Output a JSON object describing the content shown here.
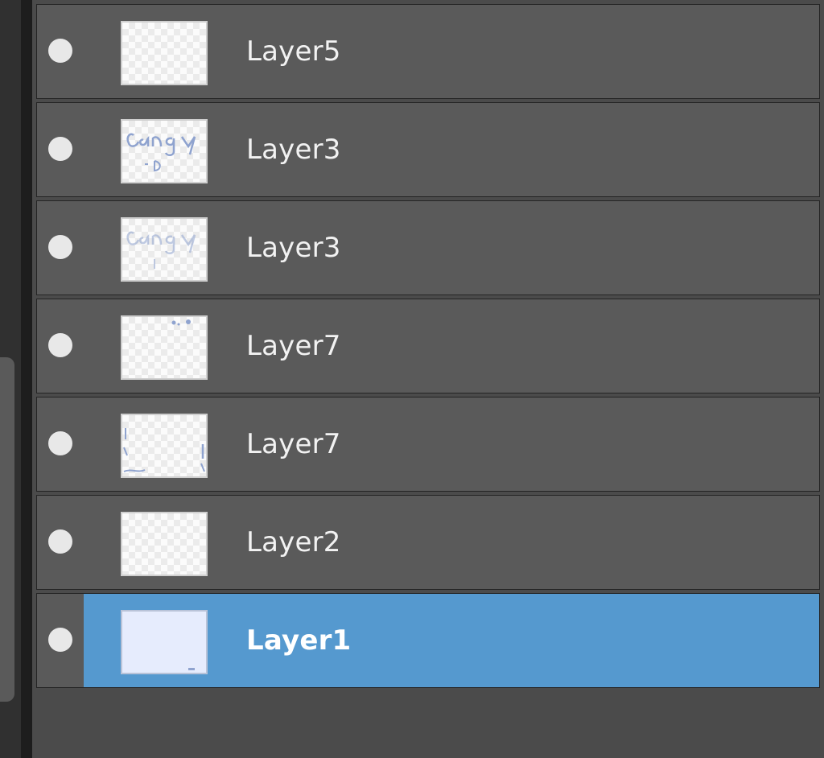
{
  "layers_panel": {
    "layers": [
      {
        "name": "Layer5",
        "thumbnail": "empty",
        "selected": false
      },
      {
        "name": "Layer3",
        "thumbnail": "text-sketch",
        "selected": false
      },
      {
        "name": "Layer3",
        "thumbnail": "text-sketch-faint",
        "selected": false
      },
      {
        "name": "Layer7",
        "thumbnail": "dots",
        "selected": false
      },
      {
        "name": "Layer7",
        "thumbnail": "edge-marks",
        "selected": false
      },
      {
        "name": "Layer2",
        "thumbnail": "empty",
        "selected": false
      },
      {
        "name": "Layer1",
        "thumbnail": "solid",
        "selected": true
      }
    ],
    "colors": {
      "row_bg": "#5a5a5a",
      "selected_bg": "#5599cf",
      "panel_bg": "#4b4b4b",
      "text": "#f2f2f2",
      "sketch": "#8fa3cf"
    }
  }
}
